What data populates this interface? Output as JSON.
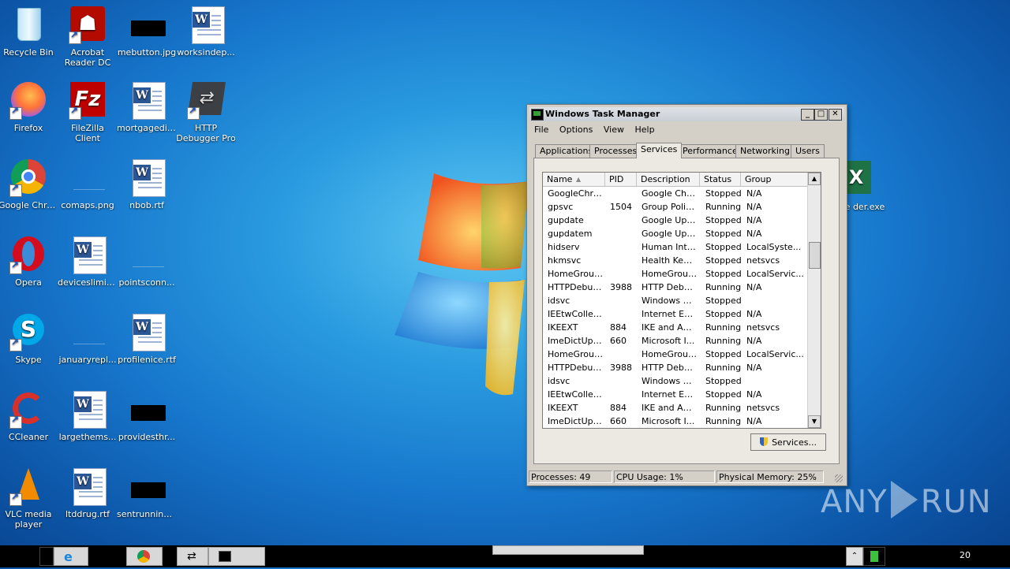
{
  "desktop": {
    "icons": [
      {
        "label": "Recycle Bin",
        "icon": "recycle-bin-icon"
      },
      {
        "label": "Acrobat Reader DC",
        "icon": "acrobat-icon"
      },
      {
        "label": "mebutton.jpg",
        "icon": "image-file-icon"
      },
      {
        "label": "worksindep...",
        "icon": "word-doc-icon"
      },
      {
        "label": "Firefox",
        "icon": "firefox-icon"
      },
      {
        "label": "FileZilla Client",
        "icon": "filezilla-icon"
      },
      {
        "label": "mortgagedis...",
        "icon": "word-doc-icon"
      },
      {
        "label": "HTTP Debugger Pro",
        "icon": "http-debugger-icon"
      },
      {
        "label": "Google Chrome",
        "icon": "chrome-icon"
      },
      {
        "label": "comaps.png",
        "icon": "image-file-icon"
      },
      {
        "label": "nbob.rtf",
        "icon": "word-doc-icon"
      },
      {
        "label": "Opera",
        "icon": "opera-icon"
      },
      {
        "label": "deviceslimit...",
        "icon": "word-doc-icon"
      },
      {
        "label": "pointsconn...",
        "icon": "image-file-icon"
      },
      {
        "label": "Skype",
        "icon": "skype-icon"
      },
      {
        "label": "januaryrepl...",
        "icon": "image-file-icon"
      },
      {
        "label": "profilenice.rtf",
        "icon": "word-doc-icon"
      },
      {
        "label": "CCleaner",
        "icon": "ccleaner-icon"
      },
      {
        "label": "largethems...",
        "icon": "word-doc-icon"
      },
      {
        "label": "providesthr...",
        "icon": "image-file-icon"
      },
      {
        "label": "VLC media player",
        "icon": "vlc-icon"
      },
      {
        "label": "ltddrug.rtf",
        "icon": "word-doc-icon"
      },
      {
        "label": "sentrunning...",
        "icon": "image-file-icon"
      },
      {
        "label": "Lime der.exe",
        "icon": "excel-icon"
      }
    ]
  },
  "taskmgr": {
    "title": "Windows Task Manager",
    "menu": [
      "File",
      "Options",
      "View",
      "Help"
    ],
    "tabs": [
      "Applications",
      "Processes",
      "Services",
      "Performance",
      "Networking",
      "Users"
    ],
    "active_tab": "Services",
    "columns": [
      "Name",
      "PID",
      "Description",
      "Status",
      "Group"
    ],
    "rows": [
      [
        "GoogleChro...",
        "",
        "Google Chr...",
        "Stopped",
        "N/A"
      ],
      [
        "gpsvc",
        "1504",
        "Group Polic...",
        "Running",
        "N/A"
      ],
      [
        "gupdate",
        "",
        "Google Upd...",
        "Stopped",
        "N/A"
      ],
      [
        "gupdatem",
        "",
        "Google Upd...",
        "Stopped",
        "N/A"
      ],
      [
        "hidserv",
        "",
        "Human Inte...",
        "Stopped",
        "LocalSyste..."
      ],
      [
        "hkmsvc",
        "",
        "Health Key ...",
        "Stopped",
        "netsvcs"
      ],
      [
        "HomeGroup...",
        "",
        "HomeGroup...",
        "Stopped",
        "LocalServic..."
      ],
      [
        "HTTPDebug...",
        "3988",
        "HTTP Debu...",
        "Running",
        "N/A"
      ],
      [
        "idsvc",
        "",
        "Windows C...",
        "Stopped",
        ""
      ],
      [
        "IEEtwCollec...",
        "",
        "Internet Ex...",
        "Stopped",
        "N/A"
      ],
      [
        "IKEEXT",
        "884",
        "IKE and Au...",
        "Running",
        "netsvcs"
      ],
      [
        "ImeDictUpd...",
        "660",
        "Microsoft I...",
        "Running",
        "N/A"
      ],
      [
        "HomeGroup...",
        "",
        "HomeGroup...",
        "Stopped",
        "LocalServic..."
      ],
      [
        "HTTPDebug...",
        "3988",
        "HTTP Debu...",
        "Running",
        "N/A"
      ],
      [
        "idsvc",
        "",
        "Windows C...",
        "Stopped",
        ""
      ],
      [
        "IEEtwCollec...",
        "",
        "Internet Ex...",
        "Stopped",
        "N/A"
      ],
      [
        "IKEEXT",
        "884",
        "IKE and Au...",
        "Running",
        "netsvcs"
      ],
      [
        "ImeDictUpd...",
        "660",
        "Microsoft I...",
        "Running",
        "N/A"
      ]
    ],
    "services_button": "Services...",
    "status": {
      "processes": "Processes: 49",
      "cpu": "CPU Usage: 1%",
      "memory": "Physical Memory: 25%"
    }
  },
  "taskbar": {
    "clock": "20"
  },
  "watermark": {
    "left": "ANY",
    "right": "RUN"
  }
}
